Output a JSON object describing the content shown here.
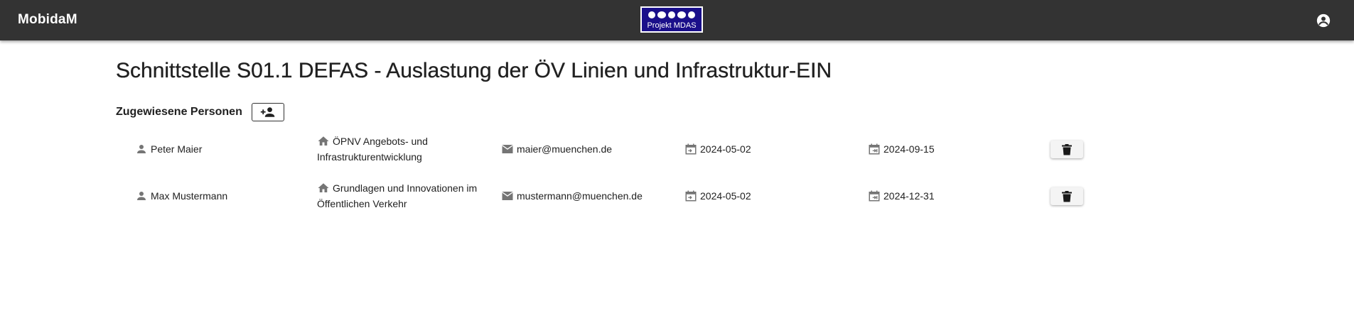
{
  "header": {
    "app_title": "MobidaM",
    "logo_text": "Projekt MDAS",
    "account_icon": "account-circle-icon"
  },
  "page": {
    "title": "Schnittstelle S01.1 DEFAS - Auslastung der ÖV Linien und Infrastruktur-EIN"
  },
  "assigned": {
    "section_title": "Zugewiesene Personen",
    "add_icon": "person-add-icon",
    "persons": [
      {
        "name": "Peter Maier",
        "department_line1": "ÖPNV Angebots- und",
        "department_line2": "Infrastrukturentwicklung",
        "email": "maier@muenchen.de",
        "start_date": "2024-05-02",
        "end_date": "2024-09-15"
      },
      {
        "name": "Max Mustermann",
        "department_line1": "Grundlagen und Innovationen im",
        "department_line2": "Öffentlichen Verkehr",
        "email": "mustermann@muenchen.de",
        "start_date": "2024-05-02",
        "end_date": "2024-12-31"
      }
    ]
  },
  "colors": {
    "topbar": "#333333",
    "logo_background": "#1a0f8a",
    "icon_grey": "#757575"
  }
}
